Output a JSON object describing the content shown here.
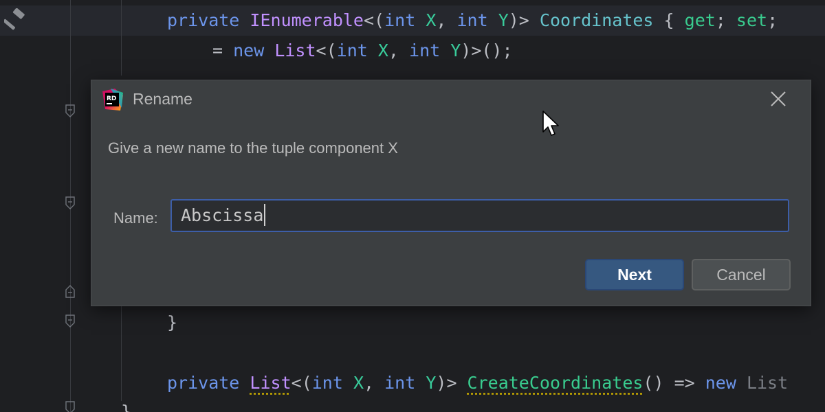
{
  "editor": {
    "lines": {
      "l1": {
        "kw1": "private",
        "iface": "IEnumerable",
        "p1": "<(",
        "kw2": "int",
        "tp1": " X",
        "p2": ", ",
        "kw3": "int",
        "tp2": " Y",
        "p3": ")> ",
        "prop": "Coordinates",
        "p4": " { ",
        "acc1": "get",
        "p5": "; ",
        "acc2": "set",
        "p6": ";"
      },
      "l2": {
        "p1": "= ",
        "kw1": "new",
        "ty": " List",
        "p2": "<(",
        "kw2": "int",
        "tp1": " X",
        "p3": ", ",
        "kw3": "int",
        "tp2": " Y",
        "p4": ")>();"
      },
      "l3": {
        "brace": "}"
      },
      "l4": {
        "kw1": "private",
        "ty": "List",
        "p1": "<(",
        "kw2": "int",
        "tp1": " X",
        "p2": ", ",
        "kw3": "int",
        "tp2": " Y",
        "p3": ")> ",
        "meth": "CreateCoordinates",
        "p4": "() => ",
        "kw4": "new",
        "dim": " List"
      },
      "l5": {
        "brace": "}"
      }
    }
  },
  "dialog": {
    "title": "Rename",
    "logo_text": "RD",
    "message": "Give a new name to the tuple component X",
    "name_label": "Name:",
    "name_value": "Abscissa",
    "next_label": "Next",
    "cancel_label": "Cancel"
  },
  "colors": {
    "editor_bg": "#1e1f22",
    "dialog_bg": "#3c3f41",
    "accent": "#365880",
    "focus_border": "#3d5ea8",
    "keyword": "#6c95eb",
    "type": "#c191ff",
    "property": "#66c3cc",
    "method": "#39cc8f"
  },
  "icons": [
    "hammer-icon",
    "fold-marker-icon",
    "rider-logo-icon",
    "close-icon",
    "mouse-cursor-icon"
  ]
}
